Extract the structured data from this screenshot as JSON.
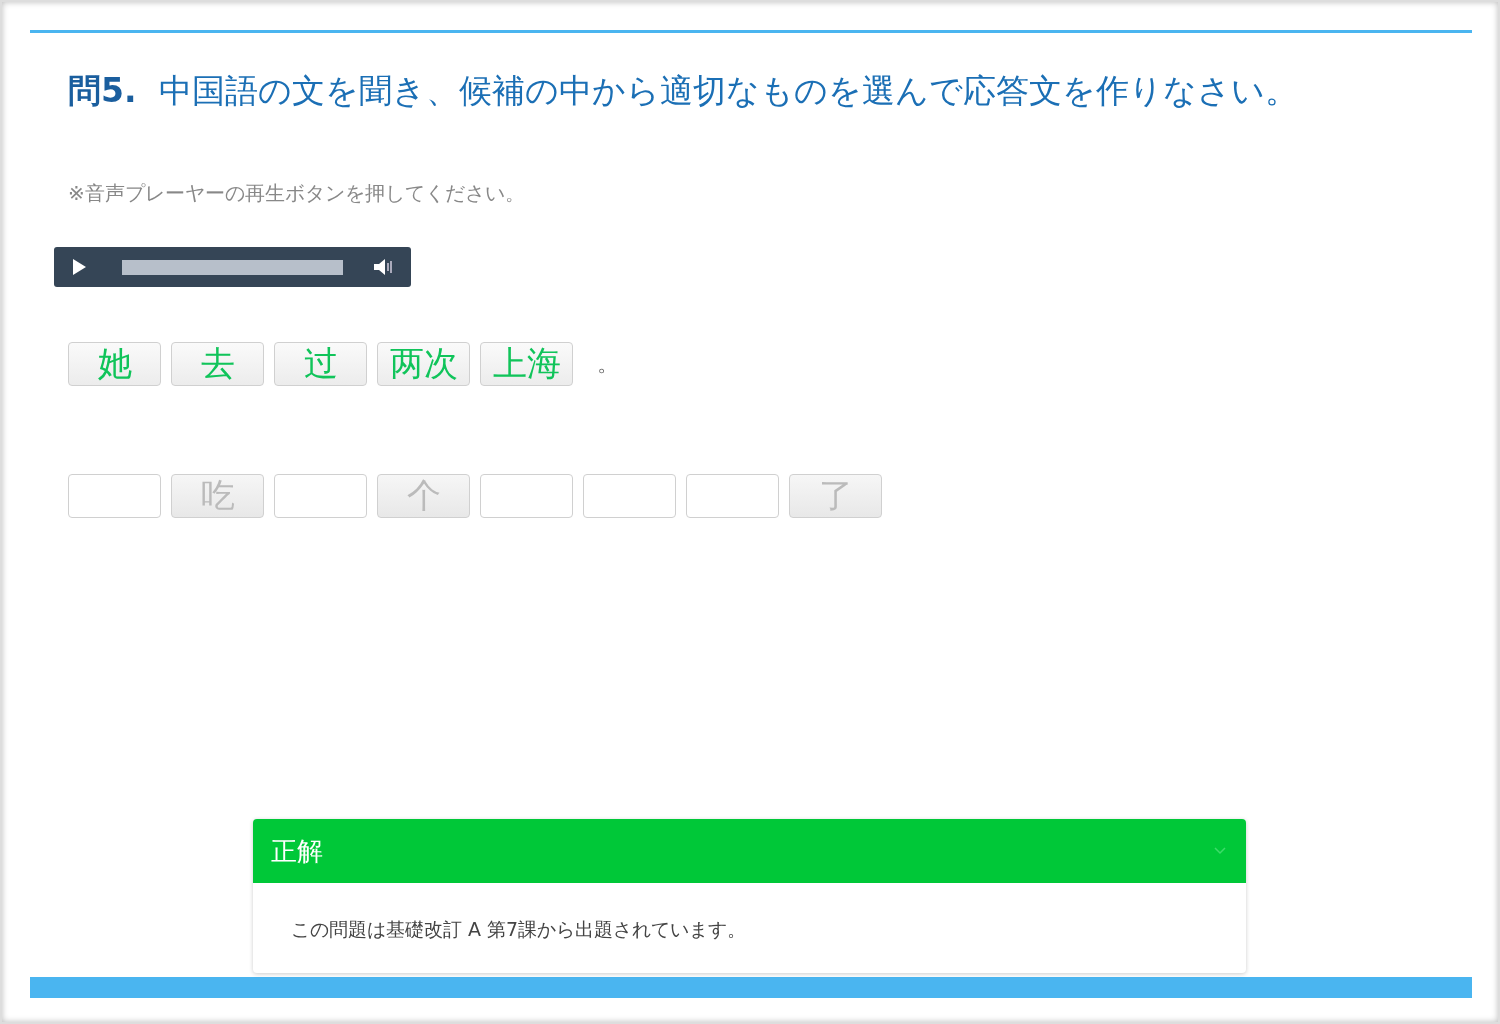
{
  "question": {
    "number": "問5.",
    "text": "中国語の文を聞き、候補の中から適切なものを選んで応答文を作りなさい。"
  },
  "instruction": "※音声プレーヤーの再生ボタンを押してください。",
  "answer_words": [
    {
      "text": "她"
    },
    {
      "text": "去"
    },
    {
      "text": "过"
    },
    {
      "text": "两次"
    },
    {
      "text": "上海"
    }
  ],
  "answer_end": "。",
  "choices": [
    {
      "kind": "blank"
    },
    {
      "kind": "word",
      "text": "吃"
    },
    {
      "kind": "blank"
    },
    {
      "kind": "word",
      "text": "个"
    },
    {
      "kind": "blank"
    },
    {
      "kind": "blank"
    },
    {
      "kind": "blank"
    },
    {
      "kind": "word",
      "text": "了"
    }
  ],
  "result_panel": {
    "title": "正解",
    "expanded": true,
    "message": "この問題は基礎改訂 A 第7課から出題されています。"
  }
}
